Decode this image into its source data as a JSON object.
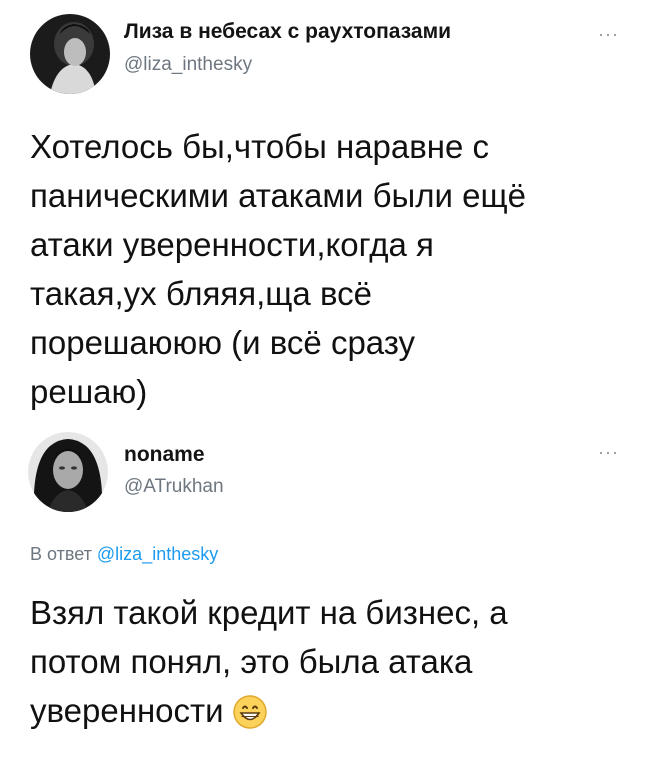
{
  "tweet_1": {
    "author_name": "Лиза в небесах с раухтопазами",
    "author_handle": "@liza_inthesky",
    "more_label": "···",
    "text_lines": [
      "Хотелось бы,чтобы наравне с",
      "паническими атаками были ещё",
      "атаки уверенности,когда я",
      "такая,ух бляяя,ща всё",
      "порешаююю (и всё сразу",
      "решаю)"
    ]
  },
  "tweet_2": {
    "author_name": "noname",
    "author_handle": "@ATrukhan",
    "more_label": "···",
    "reply_prefix": "В ответ",
    "reply_handle": "@liza_inthesky",
    "text_lines": [
      "Взял такой кредит на бизнес, а",
      "потом понял, это была атака",
      "уверенности"
    ],
    "emoji": "grinning-face-icon"
  },
  "colors": {
    "secondary_text": "#6e7780",
    "link": "#1d9bf0",
    "primary_text": "#111111"
  }
}
